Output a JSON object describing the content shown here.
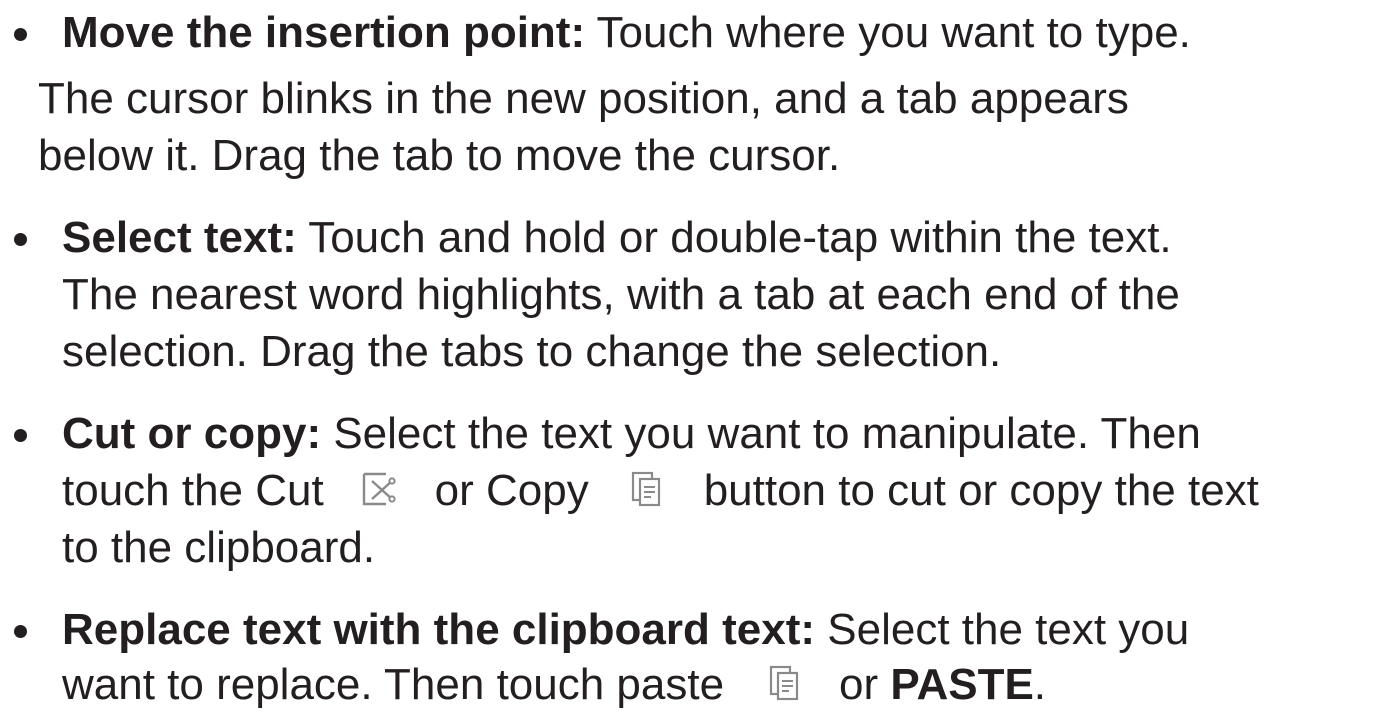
{
  "items": [
    {
      "heading": "Move the insertion point:",
      "text": " Touch where you want to type."
    },
    {
      "note_lines": [
        "The cursor blinks in the new position, and a tab appears",
        "below it. Drag the tab to move the cursor."
      ]
    },
    {
      "heading": "Select text:",
      "lines": [
        " Touch and hold or double-tap within the text.",
        "The nearest word highlights, with a tab at each end of the",
        "selection. Drag the tabs to change the selection."
      ]
    },
    {
      "heading": "Cut or copy:",
      "line1_text": " Select the text you want to manipulate. Then",
      "line2_a": "touch the Cut",
      "line2_b": "or Copy",
      "line2_c": "button to cut or copy the text",
      "line3": "to the clipboard."
    },
    {
      "heading": "Replace text with the clipboard text:",
      "line1_text": " Select the text you",
      "line2_a": "want to replace. Then touch paste",
      "line2_b": "or",
      "line2_c": "PASTE",
      "line2_d": "."
    }
  ],
  "icons": {
    "cut": "cut-icon",
    "copy": "copy-icon",
    "paste": "paste-icon",
    "icon_color": "#8a8a8a"
  }
}
